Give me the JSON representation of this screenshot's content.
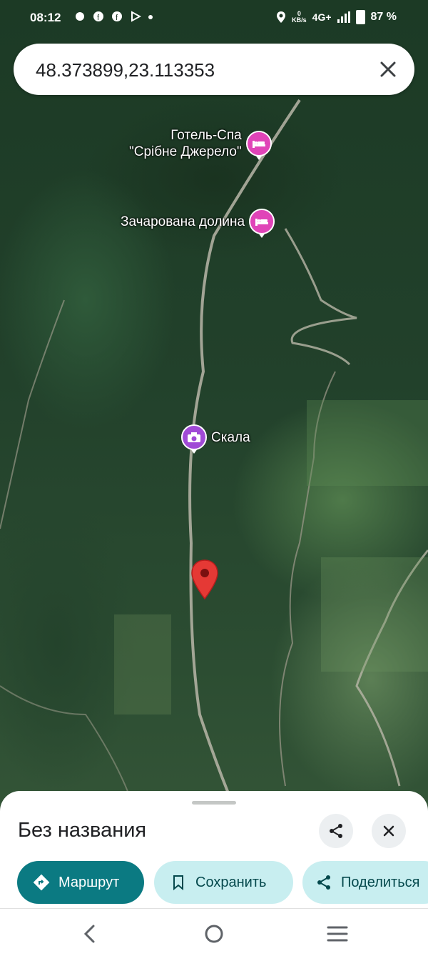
{
  "status_bar": {
    "time": "08:12",
    "net_speed": "0",
    "net_unit": "KB/s",
    "network": "4G+",
    "battery": "87 %"
  },
  "search": {
    "query": "48.373899,23.113353",
    "clear_icon": "close-icon"
  },
  "map": {
    "pois": [
      {
        "label_line1": "Готель-Спа",
        "label_line2": "\"Срібне Джерело\"",
        "icon": "hotel-icon",
        "color": "#e044b8"
      },
      {
        "label": "Зачарована долина",
        "icon": "hotel-icon",
        "color": "#e044b8"
      },
      {
        "label": "Скала",
        "icon": "camera-icon",
        "color": "#a04ad6"
      }
    ],
    "dropped_pin": {
      "icon": "location-pin-icon",
      "color": "#e53935"
    }
  },
  "place_sheet": {
    "title": "Без названия",
    "share_icon": "share-icon",
    "close_icon": "close-icon",
    "actions": [
      {
        "label": "Маршрут",
        "icon": "directions-icon"
      },
      {
        "label": "Сохранить",
        "icon": "bookmark-icon"
      },
      {
        "label": "Поделиться",
        "icon": "share-icon"
      }
    ]
  },
  "nav_bar": {
    "back": "back-icon",
    "home": "home-icon",
    "recents": "recents-icon"
  },
  "colors": {
    "accent": "#0b7a82",
    "chip_bg": "#c8eef0",
    "hotel_pin": "#e044b8",
    "photo_pin": "#a04ad6",
    "pin": "#e53935"
  }
}
